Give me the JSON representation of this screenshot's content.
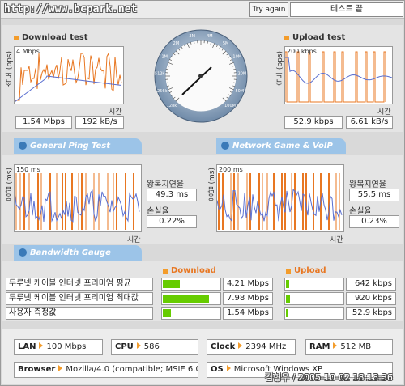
{
  "topbar": {
    "url": "http://www.bcpark.net",
    "try_again": "Try again",
    "end_test": "테스트 끝"
  },
  "download": {
    "title": "Download test",
    "ylabel": "속도 (bps)",
    "scale": "4 Mbps",
    "xlabel": "시간",
    "mbps": "1.54 Mbps",
    "kbs": "192 kB/s"
  },
  "upload": {
    "title": "Upload test",
    "ylabel": "속도 (bps)",
    "scale": "200 kbps",
    "xlabel": "시간",
    "kbps": "52.9 kbps",
    "kbs": "6.61 kB/s"
  },
  "gauge": {
    "ticks": [
      "128k",
      "256k",
      "512k",
      "1M",
      "2M",
      "3M",
      "4M",
      "5M",
      "10M",
      "20M",
      "50M",
      "100M"
    ]
  },
  "tabs": {
    "ping": "General Ping Test",
    "game": "Network Game & VoIP Test",
    "bandwidth": "Bandwidth Gauge"
  },
  "ping": {
    "ylabel": "응답 (ms)",
    "scale": "150 ms",
    "xlabel": "시간",
    "rtt_label": "왕복지연율",
    "rtt": "49.3 ms",
    "loss_label": "손실율",
    "loss": "0.22%"
  },
  "game": {
    "ylabel": "응답 (ms)",
    "scale": "200 ms",
    "xlabel": "시간",
    "rtt_label": "왕복지연율",
    "rtt": "55.5 ms",
    "loss_label": "손실율",
    "loss": "0.23%"
  },
  "bandwidth": {
    "download_header": "Download",
    "upload_header": "Upload",
    "rows": [
      {
        "label": "두루넷 케이블 인터넷 프리미엄 평균",
        "down": "4.21 Mbps",
        "down_frac": 0.3,
        "up": "642 kbps",
        "up_frac": 0.06
      },
      {
        "label": "두루넷 케이블 인터넷 프리미엄 최대값",
        "down": "7.98 Mbps",
        "down_frac": 0.82,
        "up": "920 kbps",
        "up_frac": 0.07
      },
      {
        "label": "사용자 측정값",
        "down": "1.54 Mbps",
        "down_frac": 0.14,
        "up": "52.9 kbps",
        "up_frac": 0.03
      }
    ]
  },
  "info": {
    "lan_label": "LAN",
    "lan": "100 Mbps",
    "cpu_label": "CPU",
    "cpu": "586",
    "clock_label": "Clock",
    "clock": "2394 MHz",
    "ram_label": "RAM",
    "ram": "512 MB",
    "browser_label": "Browser",
    "browser": "Mozilla/4.0 (compatible; MSIE 6.0",
    "os_label": "OS",
    "os": "Microsoft Windows XP"
  },
  "signature": "김형우 / 2005-10-02 18:18:36",
  "colors": {
    "orange": "#e87722",
    "blue": "#5a6fd0",
    "green": "#66cc00",
    "tab": "#9cc4e8"
  }
}
